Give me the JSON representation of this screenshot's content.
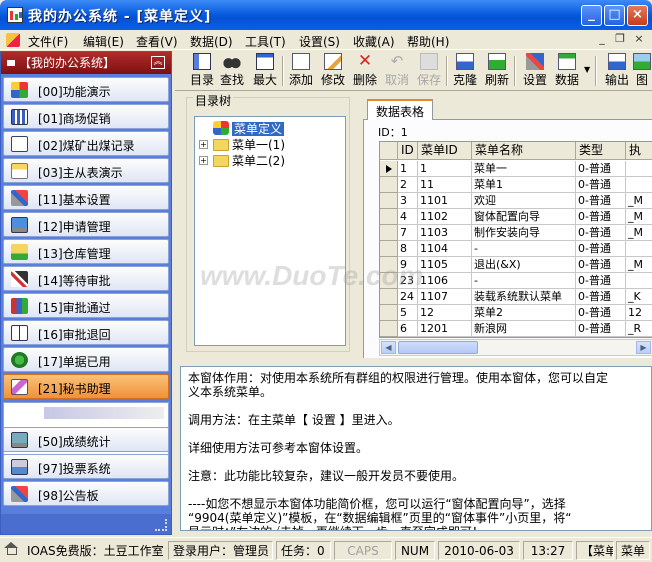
{
  "window": {
    "title": "我的办公系统 - [菜单定义]"
  },
  "menubar": {
    "items": [
      "文件(F)",
      "编辑(E)",
      "查看(V)",
      "数据(D)",
      "工具(T)",
      "设置(S)",
      "收藏(A)",
      "帮助(H)"
    ]
  },
  "sidebar": {
    "header": "【我的办公系统】",
    "items": [
      {
        "label": "[00]功能演示",
        "icon": "windows-logo-icon"
      },
      {
        "label": "[01]商场促销",
        "icon": "grid-icon"
      },
      {
        "label": "[02]煤矿出煤记录",
        "icon": "document-icon"
      },
      {
        "label": "[03]主从表演示",
        "icon": "form-icon"
      },
      {
        "label": "[11]基本设置",
        "icon": "tools-icon"
      },
      {
        "label": "[12]申请管理",
        "icon": "monitor-icon"
      },
      {
        "label": "[13]仓库管理",
        "icon": "folder-arrow-icon"
      },
      {
        "label": "[14]等待审批",
        "icon": "scissors-icon"
      },
      {
        "label": "[15]审批通过",
        "icon": "books-icon"
      },
      {
        "label": "[16]审批退回",
        "icon": "open-book-icon"
      },
      {
        "label": "[17]单据已用",
        "icon": "coins-icon"
      },
      {
        "label": "[21]秘书助理",
        "icon": "picture-icon"
      },
      {
        "label": "[50]成绩统计",
        "icon": "monitor-chart-icon"
      },
      {
        "label": "[97]投票系统",
        "icon": "ballot-icon"
      },
      {
        "label": "[98]公告板",
        "icon": "tools-icon"
      }
    ]
  },
  "toolbar": {
    "buttons": [
      {
        "label": "目录",
        "icon": "catalog-icon",
        "enabled": true
      },
      {
        "label": "查找",
        "icon": "binoculars-icon",
        "enabled": true
      },
      {
        "label": "最大",
        "icon": "maximize-icon",
        "enabled": true
      },
      {
        "label": "添加",
        "icon": "add-doc-icon",
        "enabled": true
      },
      {
        "label": "修改",
        "icon": "edit-icon",
        "enabled": true
      },
      {
        "label": "删除",
        "icon": "delete-icon",
        "enabled": true
      },
      {
        "label": "取消",
        "icon": "undo-icon",
        "enabled": false
      },
      {
        "label": "保存",
        "icon": "save-icon",
        "enabled": false
      },
      {
        "label": "克隆",
        "icon": "clone-icon",
        "enabled": true
      },
      {
        "label": "刷新",
        "icon": "refresh-icon",
        "enabled": true
      },
      {
        "label": "设置",
        "icon": "settings-icon",
        "enabled": true
      },
      {
        "label": "数据",
        "icon": "data-icon",
        "enabled": true
      },
      {
        "label": "输出",
        "icon": "export-icon",
        "enabled": true
      },
      {
        "label": "图",
        "icon": "image-icon",
        "enabled": true
      }
    ]
  },
  "tree": {
    "group_title": "目录树",
    "root": "菜单定义",
    "children": [
      "菜单一(1)",
      "菜单二(2)"
    ]
  },
  "grid": {
    "tab_label": "数据表格",
    "id_label": "ID：1",
    "columns": [
      "ID",
      "菜单ID",
      "菜单名称",
      "类型",
      "执"
    ],
    "rows": [
      [
        "1",
        "1",
        "菜单一",
        "0-普通",
        ""
      ],
      [
        "2",
        "11",
        "菜单1",
        "0-普通",
        ""
      ],
      [
        "3",
        "1101",
        "欢迎",
        "0-普通",
        "_M"
      ],
      [
        "4",
        "1102",
        "窗体配置向导",
        "0-普通",
        "_M"
      ],
      [
        "7",
        "1103",
        "制作安装向导",
        "0-普通",
        "_M"
      ],
      [
        "8",
        "1104",
        "-",
        "0-普通",
        ""
      ],
      [
        "9",
        "1105",
        "退出(&X)",
        "0-普通",
        "_M"
      ],
      [
        "23",
        "1106",
        "-",
        "0-普通",
        ""
      ],
      [
        "24",
        "1107",
        "装载系统默认菜单",
        "0-普通",
        "_K"
      ],
      [
        "5",
        "12",
        "菜单2",
        "0-普通",
        "12"
      ],
      [
        "6",
        "1201",
        "新浪网",
        "0-普通",
        "_R"
      ]
    ]
  },
  "description": {
    "lines": [
      "本窗体作用：对使用本系统所有群组的权限进行管理。使用本窗体，您可以自定",
      "义本系统菜单。",
      "",
      "调用方法：在主菜单【 设置 】里进入。",
      "",
      "详细使用方法可参考本窗体设置。",
      "",
      "注意：此功能比较复杂，建议一般开发员不要使用。",
      "",
      "----如您不想显示本窗体功能简价框，您可以运行“窗体配置向导”，选择",
      "  “9904(菜单定义)”模板，在“数据编辑框”页里的“窗体事件”小页里，将“",
      "显示时：”左边的√去掉，再继续下一步，直至完成即可！"
    ]
  },
  "statusbar": {
    "version": "IOAS免费版：土豆工作室",
    "user": "登录用户：管理员",
    "tasks": "任务：0",
    "caps": "CAPS",
    "num": "NUM",
    "date": "2010-06-03",
    "time": "13:27",
    "window": "【菜单",
    "menu": "菜单"
  },
  "watermark": "www.DuoTe.com"
}
